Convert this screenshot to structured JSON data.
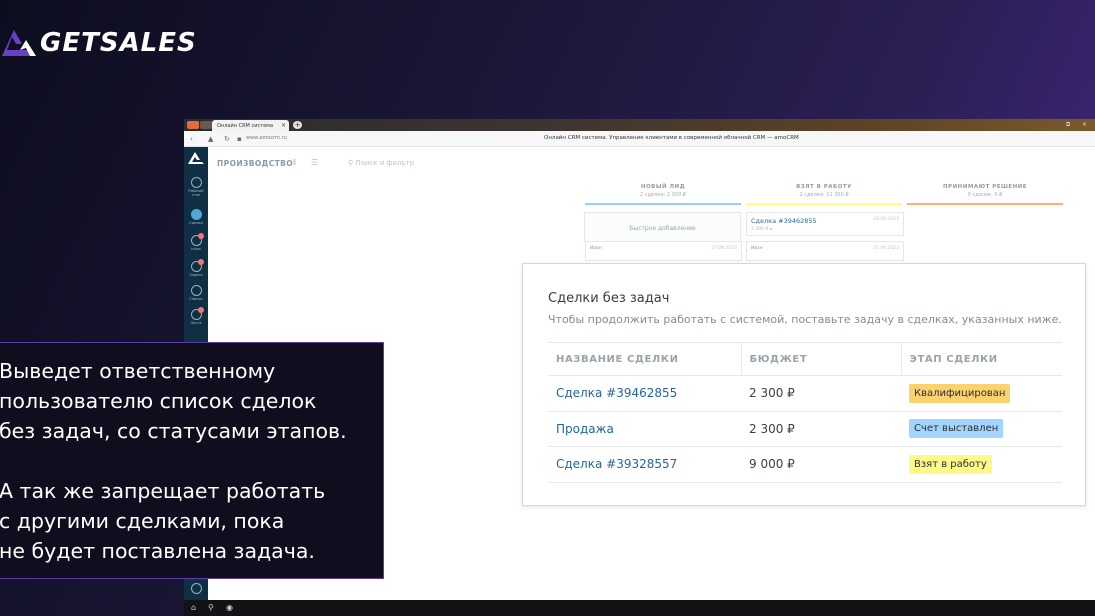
{
  "brand": {
    "name": "GETSALES",
    "logo_icon": "getsales-mark",
    "accent": "#6b3fc1"
  },
  "browser": {
    "tab_title": "Онлайн CRM система",
    "tab_close": "×",
    "new_tab": "+",
    "url": "www.amocrm.ru",
    "page_title": "Онлайн CRM система. Управление клиентами в современной облачной CRM — amoCRM",
    "window_controls": [
      "⧉",
      "×"
    ]
  },
  "app": {
    "pipeline_title": "ПРОИЗВОДСТВО",
    "search_placeholder": "Поиск и фильтр",
    "sidebar": [
      {
        "label": "Рабочий стол",
        "icon": "dashboard-icon"
      },
      {
        "label": "Сделки",
        "icon": "deals-icon",
        "active": true
      },
      {
        "label": "Inbox",
        "icon": "inbox-icon",
        "badge": true
      },
      {
        "label": "Задачи",
        "icon": "tasks-icon",
        "badge": true
      },
      {
        "label": "Списки",
        "icon": "lists-icon"
      },
      {
        "label": "Почта",
        "icon": "mail-icon",
        "badge": true
      }
    ],
    "stages": [
      {
        "name": "НОВЫЙ ЛИД",
        "summary": "2 сделки: 2 300 ₽",
        "color": "#99ccfd"
      },
      {
        "name": "ВЗЯТ В РАБОТУ",
        "summary": "2 сделки: 11 300 ₽",
        "color": "#fffd7f"
      },
      {
        "name": "ПРИНИМАЮТ РЕШЕНИЕ",
        "summary": "0 сделок: 0 ₽",
        "color": "#fbb16c"
      }
    ],
    "quick_add": "Быстрое добавление",
    "cards": {
      "deal_title": "Сделка #39462855",
      "deal_date": "28.09.2023",
      "deal_sum": "2 300 ₽ ◂",
      "user_left": "Иван",
      "user_left_date": "27.09.2023",
      "user_right": "Иван",
      "user_right_date": "27.09.2023"
    }
  },
  "modal": {
    "title": "Сделки без задач",
    "description": "Чтобы продолжить работать с системой, поставьте задачу в сделках, указанных ниже.",
    "columns": [
      "НАЗВАНИЕ СДЕЛКИ",
      "БЮДЖЕТ",
      "ЭТАП СДЕЛКИ"
    ],
    "rows": [
      {
        "deal": "Сделка #39462855",
        "budget": "2 300 ₽",
        "stage": "Квалифицирован",
        "stage_color": "#fbd26d"
      },
      {
        "deal": "Продажа",
        "budget": "2 300 ₽",
        "stage": "Счет выставлен",
        "stage_color": "#a3d4fd"
      },
      {
        "deal": "Сделка #39328557",
        "budget": "9 000 ₽",
        "stage": "Взят в работу",
        "stage_color": "#fdfa89"
      }
    ]
  },
  "callout": {
    "paragraph1": "Выведет ответственному\nпользователю список сделок\nбез задач, со статусами этапов.",
    "paragraph2": "А так же запрещает работать\nс другими сделками, пока\nне будет поставлена задача."
  }
}
